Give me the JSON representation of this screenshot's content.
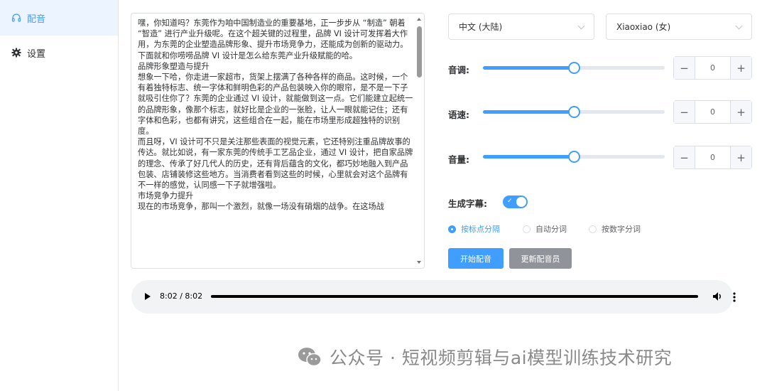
{
  "sidebar": {
    "items": [
      {
        "label": "配音",
        "icon": "headphones-icon",
        "active": true
      },
      {
        "label": "设置",
        "icon": "gear-icon",
        "active": false
      }
    ]
  },
  "editor": {
    "text": "嘿，你知道吗？东莞作为咱中国制造业的重要基地，正一步步从 “制造” 朝着 “智造” 进行产业升级呢。在这个超关键的过程里，品牌 VI 设计可发挥着大作用，为东莞的企业塑造品牌形象、提升市场竞争力，还能成为创新的驱动力。下面就和你唠唠品牌 VI 设计是怎么给东莞产业升级赋能的哈。\n品牌形象塑造与提升\n想象一下哈，你走进一家超市，货架上摆满了各种各样的商品。这时候，一个有着独特标志、统一字体和鲜明色彩的产品包装映入你的眼帘，是不是一下子就吸引住你了？东莞的企业通过 VI 设计，就能做到这一点。它们能建立起统一的品牌形象，像那个标志，就好比是企业的一张脸，让人一眼就能记住；还有字体和色彩，也都有讲究，这些组合在一起，能在市场里形成超独特的识别度。\n而且呀，VI 设计可不只是关注那些表面的视觉元素，它还特别注重品牌故事的传达。就比如说，有一家东莞的传统手工艺品企业，通过 VI 设计，把自家品牌的理念、传承了好几代人的历史，还有背后蕴含的文化，都巧妙地融入到产品包装、店铺装修这些地方。当消费者看到这些的时候，心里就会对这个品牌有不一样的感觉，认同感一下子就增强啦。\n市场竞争力提升\n现在的市场竞争，那叫一个激烈，就像一场没有硝烟的战争。在这场战"
  },
  "language_select": {
    "value": "中文 (大陆)"
  },
  "voice_select": {
    "value": "Xiaoxiao (女)"
  },
  "controls": [
    {
      "label": "音调:",
      "value": "0",
      "level": 0.5
    },
    {
      "label": "语速:",
      "value": "0",
      "level": 0.5
    },
    {
      "label": "音量:",
      "value": "0",
      "level": 0.5
    }
  ],
  "stepper": {
    "minus": "−",
    "plus": "+"
  },
  "subtitle": {
    "label": "生成字幕:",
    "enabled": true,
    "check": "✓"
  },
  "split_modes": [
    {
      "label": "按标点分隔",
      "checked": true
    },
    {
      "label": "自动分词",
      "checked": false
    },
    {
      "label": "按数字分词",
      "checked": false
    }
  ],
  "buttons": {
    "start": "开始配音",
    "refresh": "更新配音员"
  },
  "audio": {
    "time": "8:02 / 8:02",
    "progress": 1.0
  },
  "watermark": {
    "text": "公众号 · 短视频剪辑与ai模型训练技术研究"
  },
  "colors": {
    "accent": "#409eff",
    "info": "#909399"
  }
}
